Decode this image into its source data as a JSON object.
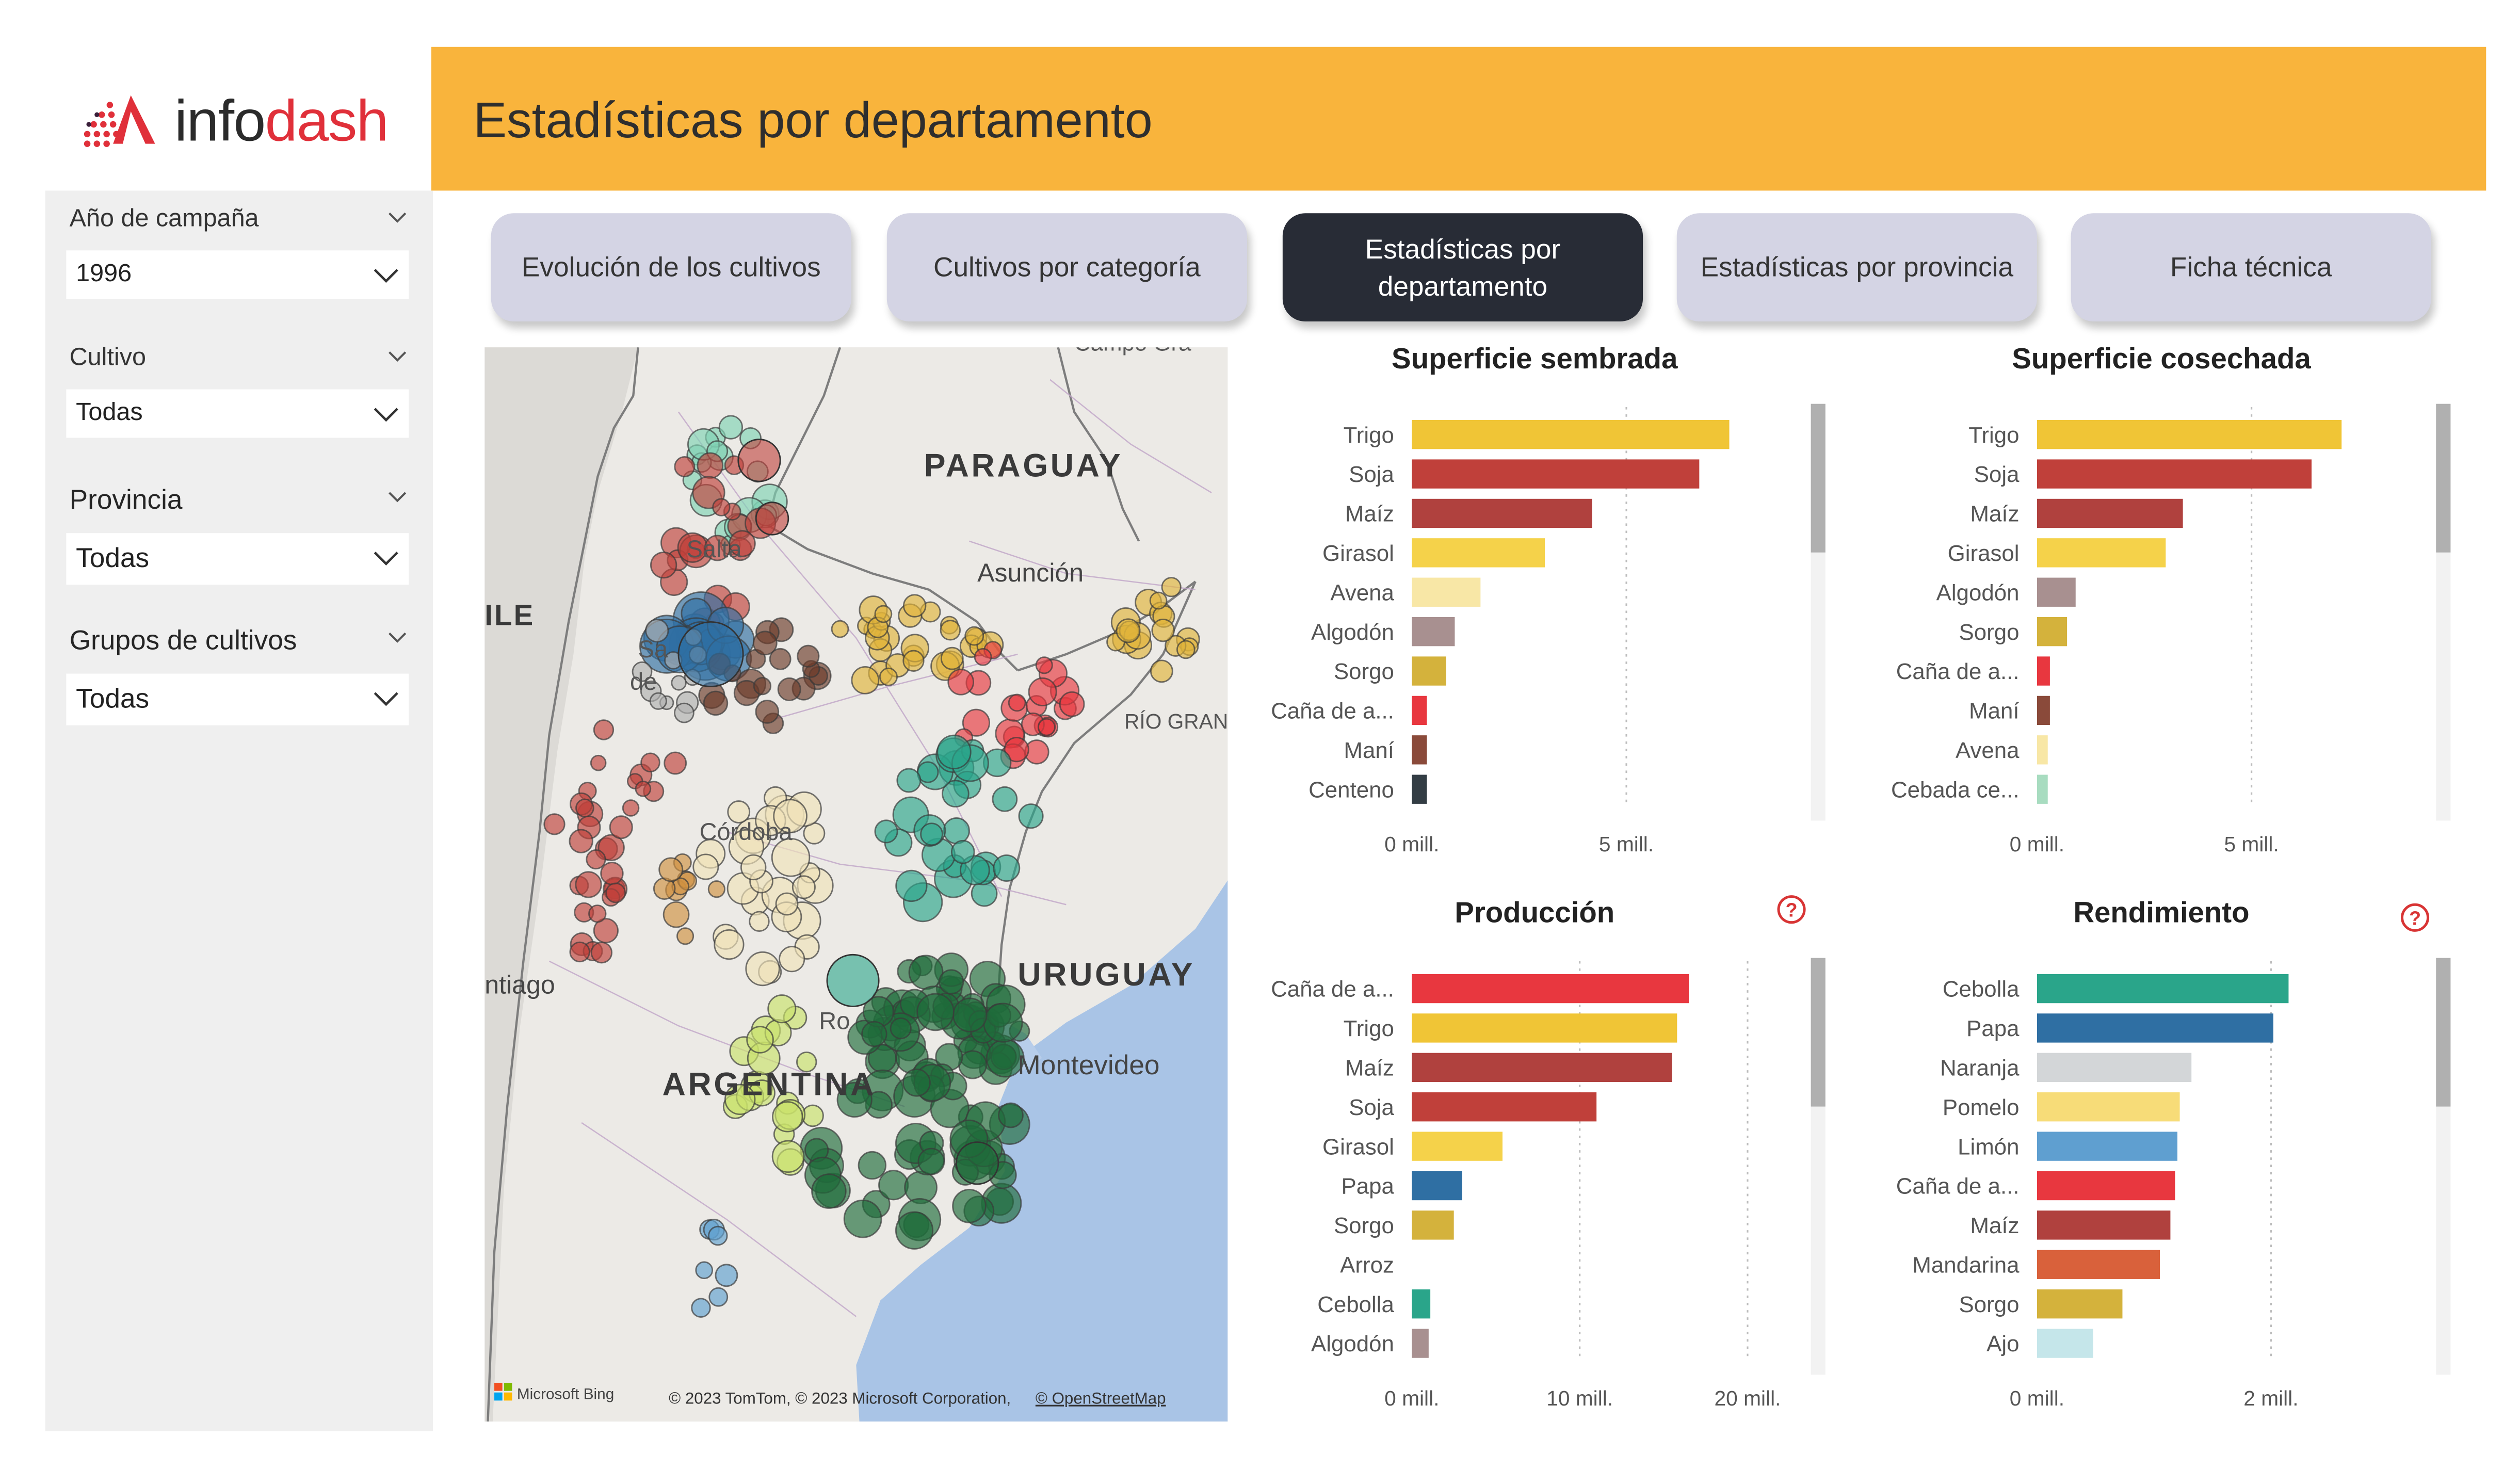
{
  "app": {
    "logo_plain": "info",
    "logo_accent": "dash"
  },
  "header": {
    "title": "Estadísticas por departamento"
  },
  "filters": {
    "year": {
      "label": "Año de campaña",
      "value": "1996"
    },
    "crop": {
      "label": "Cultivo",
      "value": "Todas"
    },
    "province": {
      "label": "Provincia",
      "value": "Todas"
    },
    "group": {
      "label": "Grupos de cultivos",
      "value": "Todas"
    }
  },
  "nav": [
    {
      "label": "Evolución de los cultivos",
      "active": false
    },
    {
      "label": "Cultivos por categoría",
      "active": false
    },
    {
      "label": "Estadísticas por departamento",
      "active": true
    },
    {
      "label": "Estadísticas por provincia",
      "active": false
    },
    {
      "label": "Ficha técnica",
      "active": false
    }
  ],
  "map": {
    "labels": {
      "paraguay": "PARAGUAY",
      "asuncion": "Asunción",
      "chile": "ILE",
      "salta": "Salta",
      "santiago_del": "Sa",
      "santiago_de": "de",
      "rio_grande": "RÍO GRAN",
      "campo": "Campo Gra",
      "cordoba": "Córdoba",
      "santiago": "ntiago",
      "uruguay": "URUGUAY",
      "montevideo": "Montevideo",
      "argentina": "ARGENTINA",
      "rosario": "Ro"
    },
    "attribution_logo": "Microsoft Bing",
    "attribution": "© 2023 TomTom, © 2023 Microsoft Corporation,",
    "attribution_link": "© OpenStreetMap"
  },
  "chart_data": [
    {
      "type": "bar",
      "orientation": "horizontal",
      "title": "Superficie sembrada",
      "categories": [
        "Trigo",
        "Soja",
        "Maíz",
        "Girasol",
        "Avena",
        "Algodón",
        "Sorgo",
        "Caña de a...",
        "Maní",
        "Centeno"
      ],
      "values": [
        7.4,
        6.7,
        4.2,
        3.1,
        1.6,
        1.0,
        0.8,
        0.35,
        0.35,
        0.35
      ],
      "colors": [
        "#f0c536",
        "#c0403a",
        "#b0413e",
        "#f5d24a",
        "#f8e7a6",
        "#a89090",
        "#d4b23c",
        "#e8373f",
        "#8a4a3a",
        "#333d44"
      ],
      "xticks": [
        "0 mill.",
        "5 mill."
      ],
      "xlim": [
        0,
        9.0
      ],
      "unit": "mill."
    },
    {
      "type": "bar",
      "orientation": "horizontal",
      "title": "Superficie cosechada",
      "categories": [
        "Trigo",
        "Soja",
        "Maíz",
        "Girasol",
        "Algodón",
        "Sorgo",
        "Caña de a...",
        "Maní",
        "Avena",
        "Cebada ce..."
      ],
      "values": [
        7.1,
        6.4,
        3.4,
        3.0,
        0.9,
        0.7,
        0.3,
        0.3,
        0.25,
        0.25
      ],
      "colors": [
        "#f0c536",
        "#c0403a",
        "#b0413e",
        "#f5d24a",
        "#a89090",
        "#d4b23c",
        "#e8373f",
        "#8a4a3a",
        "#f8e7a6",
        "#a8dcc0"
      ],
      "xticks": [
        "0 mill.",
        "5 mill."
      ],
      "xlim": [
        0,
        9.0
      ],
      "unit": "mill."
    },
    {
      "type": "bar",
      "orientation": "horizontal",
      "title": "Producción",
      "categories": [
        "Caña de a...",
        "Trigo",
        "Maíz",
        "Soja",
        "Girasol",
        "Papa",
        "Sorgo",
        "Arroz",
        "Cebolla",
        "Algodón"
      ],
      "values": [
        16.5,
        15.8,
        15.5,
        11.0,
        5.4,
        3.0,
        2.5,
        0.0,
        1.1,
        1.0
      ],
      "colors": [
        "#e8373f",
        "#f0c536",
        "#b0413e",
        "#c0403a",
        "#f5d24a",
        "#2f6fa3",
        "#d4b23c",
        "#c79b5c",
        "#2aa58a",
        "#a89090"
      ],
      "xticks": [
        "0 mill.",
        "10 mill.",
        "20 mill."
      ],
      "xlim": [
        0,
        23.0
      ],
      "unit": "mill."
    },
    {
      "type": "bar",
      "orientation": "horizontal",
      "title": "Rendimiento",
      "categories": [
        "Cebolla",
        "Papa",
        "Naranja",
        "Pomelo",
        "Limón",
        "Caña de a...",
        "Maíz",
        "Mandarina",
        "Sorgo",
        "Ajo"
      ],
      "values": [
        2.15,
        2.02,
        1.32,
        1.22,
        1.2,
        1.18,
        1.14,
        1.05,
        0.73,
        0.48
      ],
      "colors": [
        "#2aa58a",
        "#2f6fa3",
        "#d3d6d8",
        "#f7dc78",
        "#5f9fd0",
        "#e8373f",
        "#b0413e",
        "#d9613b",
        "#d4b23c",
        "#c5e6ea"
      ],
      "xticks": [
        "0 mill.",
        "2 mill."
      ],
      "xlim": [
        0,
        3.3
      ],
      "unit": "mill."
    }
  ]
}
